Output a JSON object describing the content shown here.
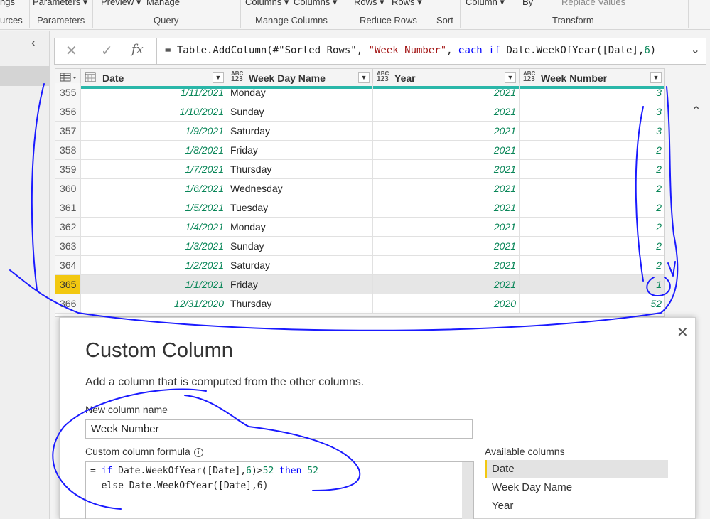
{
  "ribbon": {
    "top_items": [
      "ngs",
      "Parameters ▾",
      "Preview ▾",
      "Manage",
      "Columns ▾",
      "Columns ▾",
      "Rows ▾",
      "Rows ▾",
      "Column ▾",
      "By",
      "Replace Values"
    ],
    "groups": [
      "urces",
      "Parameters",
      "Query",
      "Manage Columns",
      "Reduce Rows",
      "Sort",
      "Transform"
    ]
  },
  "left_pane": {
    "collapse_glyph": "‹"
  },
  "formula_bar": {
    "cancel_glyph": "✕",
    "commit_glyph": "✓",
    "fx_label": "fx",
    "expr": {
      "p1": "= Table.AddColumn(#\"Sorted Rows\", ",
      "p2": "\"Week Number\"",
      "p3": ", ",
      "p4": "each",
      "p5": " ",
      "p6": "if",
      "p7": " Date.WeekOfYear([Date],",
      "p8": "6",
      "p9": ")"
    },
    "expand_glyph": "⌄"
  },
  "grid": {
    "columns": [
      {
        "name": "Date",
        "type": "date"
      },
      {
        "name": "Week Day Name",
        "type": "any"
      },
      {
        "name": "Year",
        "type": "any"
      },
      {
        "name": "Week Number",
        "type": "any"
      }
    ],
    "type_any_line1": "ABC",
    "type_any_line2": "123",
    "rows": [
      {
        "n": "355",
        "date": "1/11/2021",
        "day": "Monday",
        "year": "2021",
        "week": "3"
      },
      {
        "n": "356",
        "date": "1/10/2021",
        "day": "Sunday",
        "year": "2021",
        "week": "3"
      },
      {
        "n": "357",
        "date": "1/9/2021",
        "day": "Saturday",
        "year": "2021",
        "week": "3"
      },
      {
        "n": "358",
        "date": "1/8/2021",
        "day": "Friday",
        "year": "2021",
        "week": "2"
      },
      {
        "n": "359",
        "date": "1/7/2021",
        "day": "Thursday",
        "year": "2021",
        "week": "2"
      },
      {
        "n": "360",
        "date": "1/6/2021",
        "day": "Wednesday",
        "year": "2021",
        "week": "2"
      },
      {
        "n": "361",
        "date": "1/5/2021",
        "day": "Tuesday",
        "year": "2021",
        "week": "2"
      },
      {
        "n": "362",
        "date": "1/4/2021",
        "day": "Monday",
        "year": "2021",
        "week": "2"
      },
      {
        "n": "363",
        "date": "1/3/2021",
        "day": "Sunday",
        "year": "2021",
        "week": "2"
      },
      {
        "n": "364",
        "date": "1/2/2021",
        "day": "Saturday",
        "year": "2021",
        "week": "2"
      },
      {
        "n": "365",
        "date": "1/1/2021",
        "day": "Friday",
        "year": "2021",
        "week": "1",
        "selected": true
      },
      {
        "n": "366",
        "date": "12/31/2020",
        "day": "Thursday",
        "year": "2020",
        "week": "52"
      }
    ],
    "scroll_up_glyph": "⌃"
  },
  "dialog": {
    "close_glyph": "✕",
    "title": "Custom Column",
    "subtitle": "Add a column that is computed from the other columns.",
    "name_label": "New column name",
    "name_value": "Week Number",
    "formula_label": "Custom column formula",
    "info_glyph": "i",
    "formula_line1_a": "= ",
    "formula_line1_b": "if",
    "formula_line1_c": " Date.WeekOfYear([Date],",
    "formula_line1_d": "6",
    "formula_line1_e": ")>",
    "formula_line1_f": "52",
    "formula_line1_g": " ",
    "formula_line1_h": "then",
    "formula_line1_i": " ",
    "formula_line1_j": "52",
    "formula_line2": "  else Date.WeekOfYear([Date],6)",
    "available_label": "Available columns",
    "available_columns": [
      "Date",
      "Week Day Name",
      "Year"
    ]
  },
  "colors": {
    "accent_teal": "#2ab7a9",
    "selected_row_number": "#f2c811",
    "annotation_ink": "#1a1aff",
    "keyword_blue": "#0000ff",
    "string_red": "#a31515",
    "number_green": "#098658"
  }
}
